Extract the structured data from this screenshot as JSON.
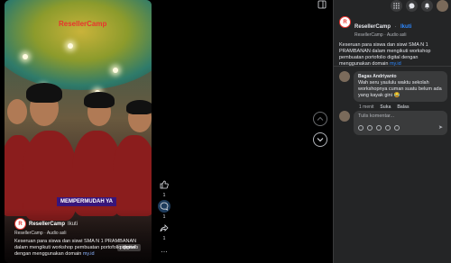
{
  "video": {
    "brand_logo": "ResellerCamp",
    "caption_chip": "MEMPERMUDAH YA",
    "page_name": "ResellerCamp",
    "follow": "Ikuti",
    "audio": "ResellerCamp · Audio asli",
    "description": "Keseruan para siswa dan siswi SMA N 1 PRAMBANAN dalam mengikuti workshop pembuatan portofolio digital dengan menggunakan domain",
    "link": "my.id",
    "badge": "pigmweb"
  },
  "rail": {
    "like_count": "1",
    "comment_count": "1",
    "share_count": "1",
    "more_label": "…"
  },
  "panel": {
    "page_name": "ResellerCamp",
    "follow": "Ikuti",
    "audio": "ResellerCamp · Audio asli",
    "description": "Keseruan para siswa dan siswi SMA N 1 PRAMBANAN dalam mengikuti workshop pembuatan portofolio digital dengan menggunakan domain",
    "link": "my.id",
    "comment": {
      "author": "Bagas Andriyanto",
      "text": "Wah seru yaululu waktu sekolah workshopnya cuman suatu belum ada yang kayak gini 😂",
      "time": "1 menit",
      "like": "Suka",
      "reply": "Balas"
    },
    "write_placeholder": "Tulis komentar...",
    "send_label": "➤"
  },
  "colors": {
    "accent": "#2d88ff",
    "brand": "#e8342e",
    "panel_bg": "#242526"
  }
}
